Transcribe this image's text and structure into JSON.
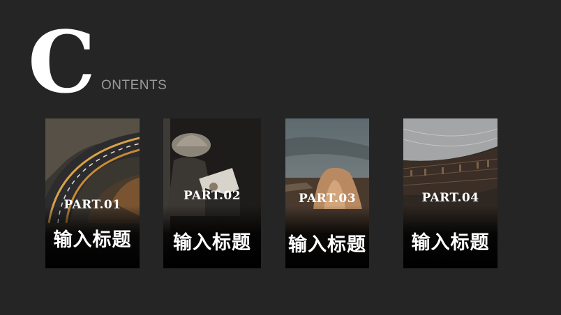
{
  "heading": {
    "initial": "C",
    "rest": "ONTENTS"
  },
  "cards": [
    {
      "part": "PART.01",
      "title": "输入标题",
      "scene_icon": "highway-road-image"
    },
    {
      "part": "PART.02",
      "title": "输入标题",
      "scene_icon": "man-reading-image"
    },
    {
      "part": "PART.03",
      "title": "输入标题",
      "scene_icon": "desert-rock-image"
    },
    {
      "part": "PART.04",
      "title": "输入标题",
      "scene_icon": "library-interior-image"
    }
  ],
  "colors": {
    "background": "#252525",
    "accent_text": "#ffffff",
    "muted_text": "#9a9a9a"
  }
}
